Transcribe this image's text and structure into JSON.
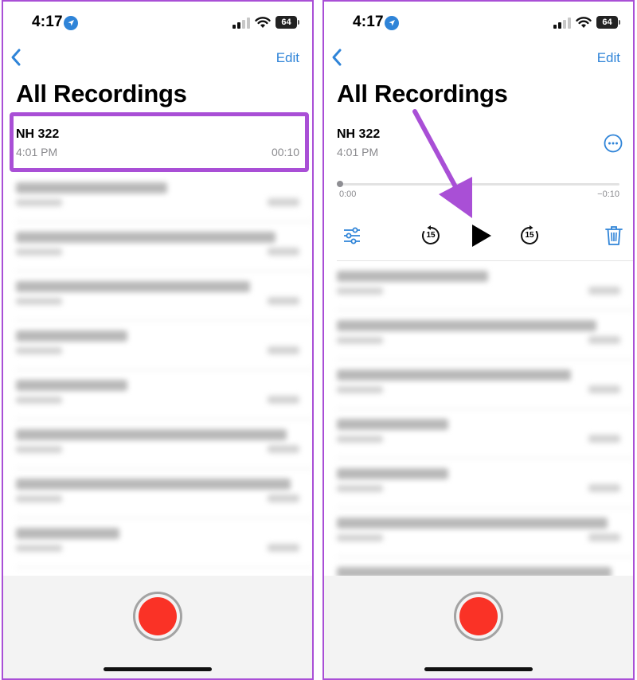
{
  "left": {
    "status": {
      "time": "4:17",
      "battery": "64"
    },
    "nav": {
      "edit_label": "Edit"
    },
    "title": "All Recordings",
    "selected_recording": {
      "name": "NH 322",
      "time": "4:01 PM",
      "duration": "00:10"
    }
  },
  "right": {
    "status": {
      "time": "4:17",
      "battery": "64"
    },
    "nav": {
      "edit_label": "Edit"
    },
    "title": "All Recordings",
    "expanded_recording": {
      "name": "NH 322",
      "time": "4:01 PM",
      "elapsed": "0:00",
      "remaining": "−0:10",
      "skip_back_seconds": "15",
      "skip_forward_seconds": "15",
      "progress": 0
    }
  },
  "colors": {
    "accent": "#2f84d8",
    "record": "#fa3226",
    "highlight": "#a94fd6"
  },
  "icons": [
    "location-arrow-icon",
    "signal-icon",
    "wifi-icon",
    "battery-icon",
    "back-chevron-icon",
    "more-icon",
    "options-sliders-icon",
    "skip-back-15-icon",
    "play-icon",
    "skip-forward-15-icon",
    "trash-icon",
    "record-icon"
  ]
}
